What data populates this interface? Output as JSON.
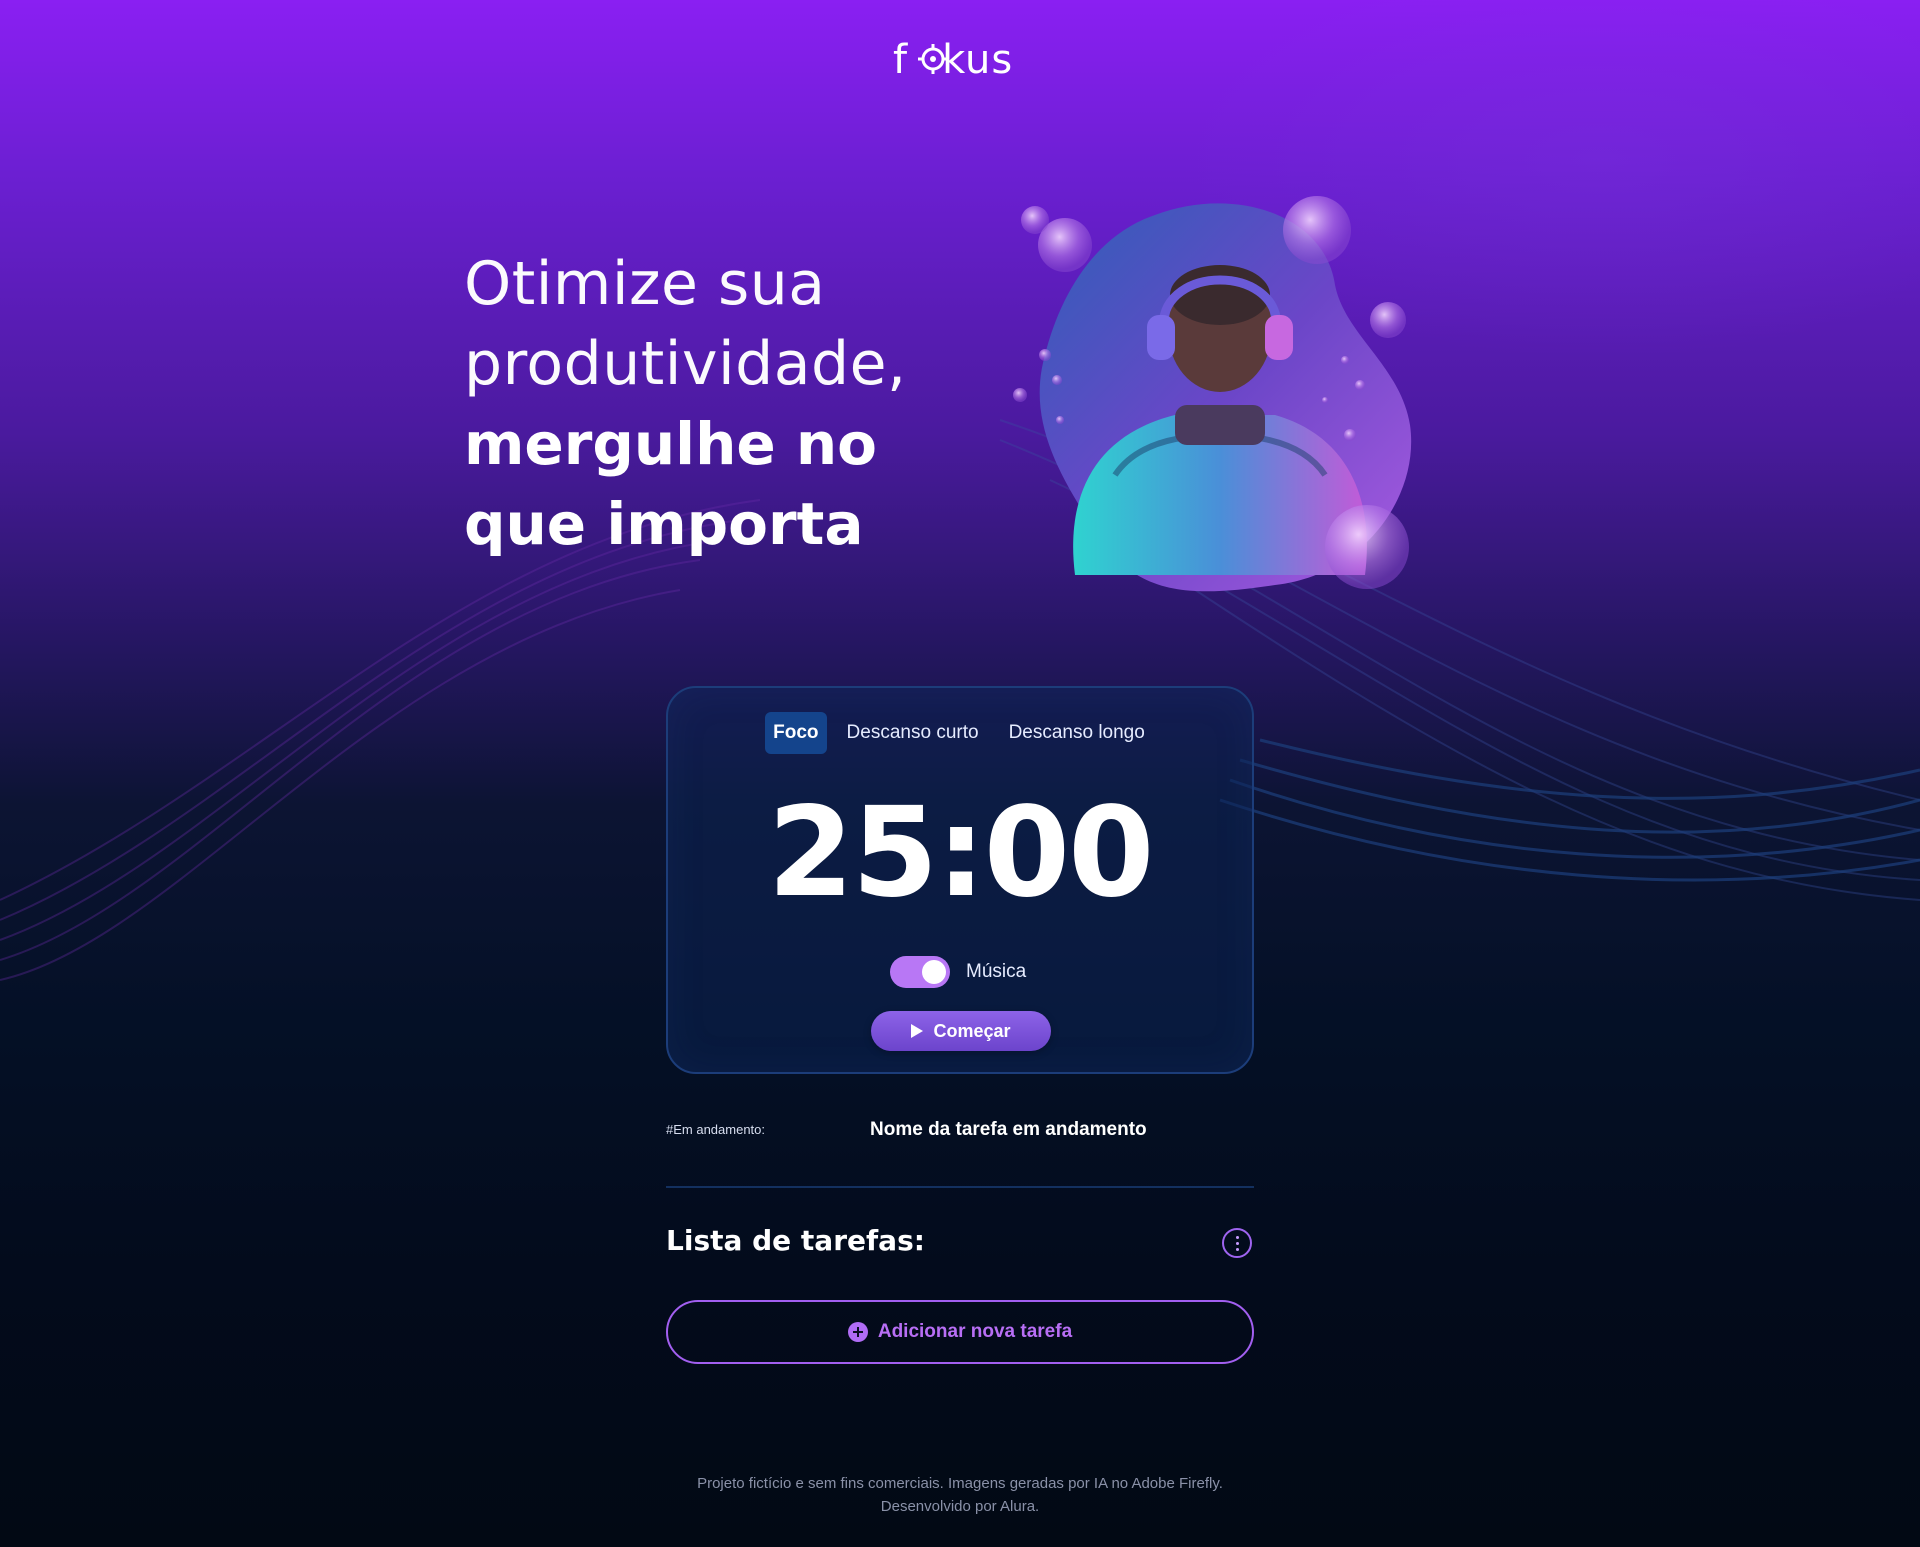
{
  "brand": {
    "logo_text": "fokus",
    "accent": "#b877f5"
  },
  "hero": {
    "line1": "Otimize sua",
    "line2": "produtividade,",
    "line3": "mergulhe no",
    "line4": "que importa"
  },
  "illustration": {
    "subject": "person-with-headphones-bubbles"
  },
  "timer": {
    "tabs": [
      {
        "label": "Foco",
        "active": true
      },
      {
        "label": "Descanso curto",
        "active": false
      },
      {
        "label": "Descanso longo",
        "active": false
      }
    ],
    "display": "25:00",
    "music_label": "Música",
    "music_on": true,
    "start_label": "Começar"
  },
  "in_progress": {
    "label": "#Em andamento:",
    "task_name": "Nome da tarefa em andamento"
  },
  "tasks": {
    "title": "Lista de tarefas:",
    "more_icon": "more-vertical-icon",
    "add_label": "Adicionar nova tarefa",
    "add_icon": "plus-circle-icon"
  },
  "footer": {
    "line1": "Projeto fictício e sem fins comerciais. Imagens geradas por IA no Adobe Firefly.",
    "line2": "Desenvolvido por Alura."
  }
}
